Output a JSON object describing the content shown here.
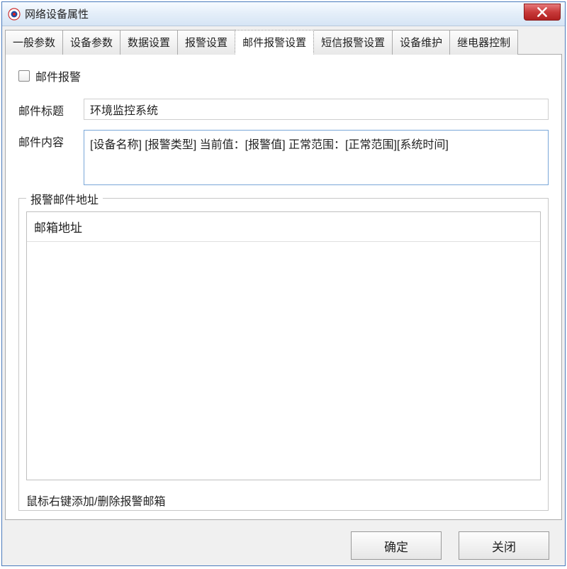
{
  "window": {
    "title": "网络设备属性"
  },
  "tabs": [
    {
      "label": "一般参数"
    },
    {
      "label": "设备参数"
    },
    {
      "label": "数据设置"
    },
    {
      "label": "报警设置"
    },
    {
      "label": "邮件报警设置"
    },
    {
      "label": "短信报警设置"
    },
    {
      "label": "设备维护"
    },
    {
      "label": "继电器控制"
    }
  ],
  "form": {
    "enable_label": "邮件报警",
    "subject_label": "邮件标题",
    "subject_value": "环境监控系统",
    "body_label": "邮件内容",
    "body_value": "[设备名称] [报警类型] 当前值：[报警值] 正常范围：[正常范围][系统时间]"
  },
  "group": {
    "legend": "报警邮件地址",
    "list_header": "邮箱地址",
    "hint": "鼠标右键添加/删除报警邮箱"
  },
  "buttons": {
    "ok": "确定",
    "close": "关闭"
  }
}
